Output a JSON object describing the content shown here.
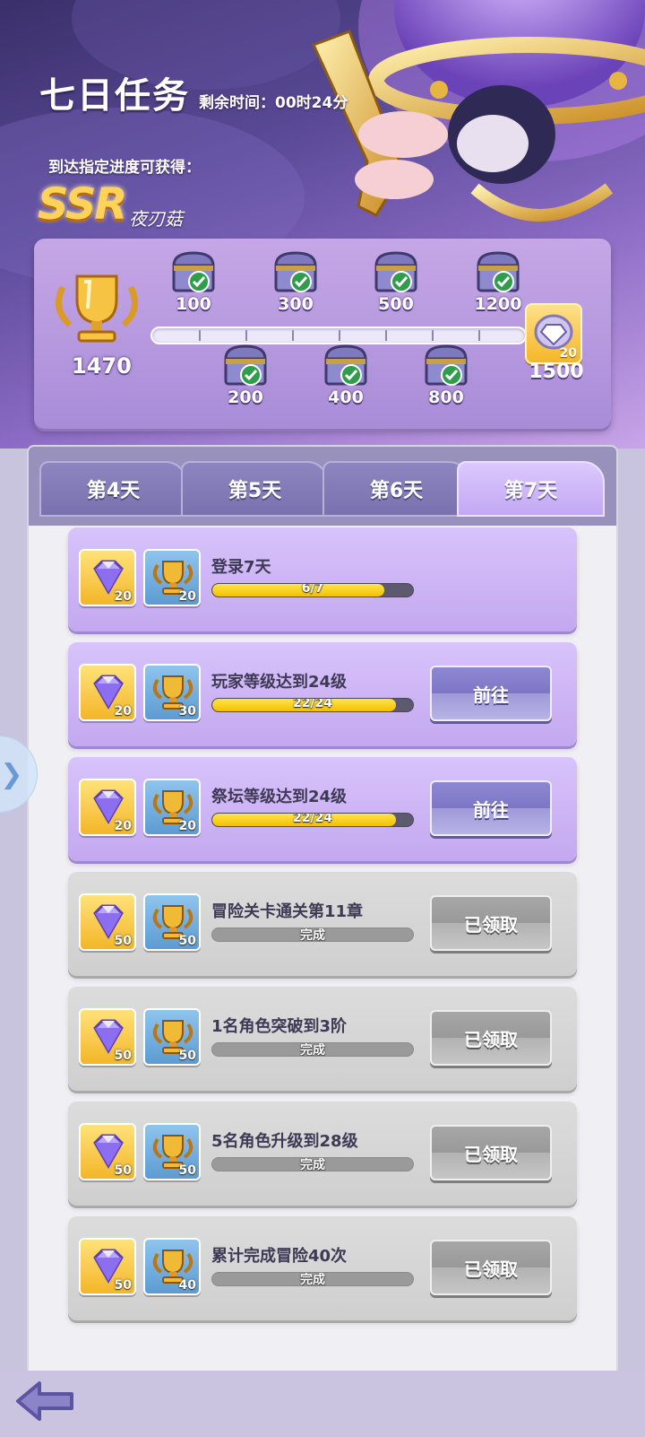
{
  "header": {
    "title": "七日任务",
    "timer_label": "剩余时间：",
    "timer_value": "00时24分",
    "reach_text": "到达指定进度可获得：",
    "reward_rarity": "SSR",
    "reward_name": "夜刃菇"
  },
  "progress": {
    "current_score": "1470",
    "current_value": 1470,
    "max_value": 1500,
    "top_milestones": [
      "100",
      "300",
      "500",
      "1200"
    ],
    "bottom_milestones": [
      "200",
      "400",
      "800"
    ],
    "final_milestone": "1500",
    "final_reward_count": "20"
  },
  "tabs": [
    "第4天",
    "第5天",
    "第6天",
    "第7天"
  ],
  "active_tab": "第7天",
  "tasks": [
    {
      "name": "登录7天",
      "gem": "20",
      "cup": "20",
      "progress_text": "6/7",
      "progress": 0.857,
      "status": "open",
      "button": ""
    },
    {
      "name": "玩家等级达到24级",
      "gem": "20",
      "cup": "30",
      "progress_text": "22/24",
      "progress": 0.917,
      "status": "open",
      "button": "前往"
    },
    {
      "name": "祭坛等级达到24级",
      "gem": "20",
      "cup": "20",
      "progress_text": "22/24",
      "progress": 0.917,
      "status": "open",
      "button": "前往"
    },
    {
      "name": "冒险关卡通关第11章",
      "gem": "50",
      "cup": "50",
      "progress_text": "完成",
      "progress": 1,
      "status": "done",
      "button": "已领取"
    },
    {
      "name": "1名角色突破到3阶",
      "gem": "50",
      "cup": "50",
      "progress_text": "完成",
      "progress": 1,
      "status": "done",
      "button": "已领取"
    },
    {
      "name": "5名角色升级到28级",
      "gem": "50",
      "cup": "50",
      "progress_text": "完成",
      "progress": 1,
      "status": "done",
      "button": "已领取"
    },
    {
      "name": "累计完成冒险40次",
      "gem": "50",
      "cup": "40",
      "progress_text": "完成",
      "progress": 1,
      "status": "done",
      "button": "已领取"
    }
  ],
  "colors": {
    "accent": "#c3a8ef",
    "progress_fill": "#f4c000",
    "header_bg": "#5a4a97"
  },
  "icons": {
    "side_toggle": "chevron-right-icon",
    "back": "back-arrow-icon"
  }
}
